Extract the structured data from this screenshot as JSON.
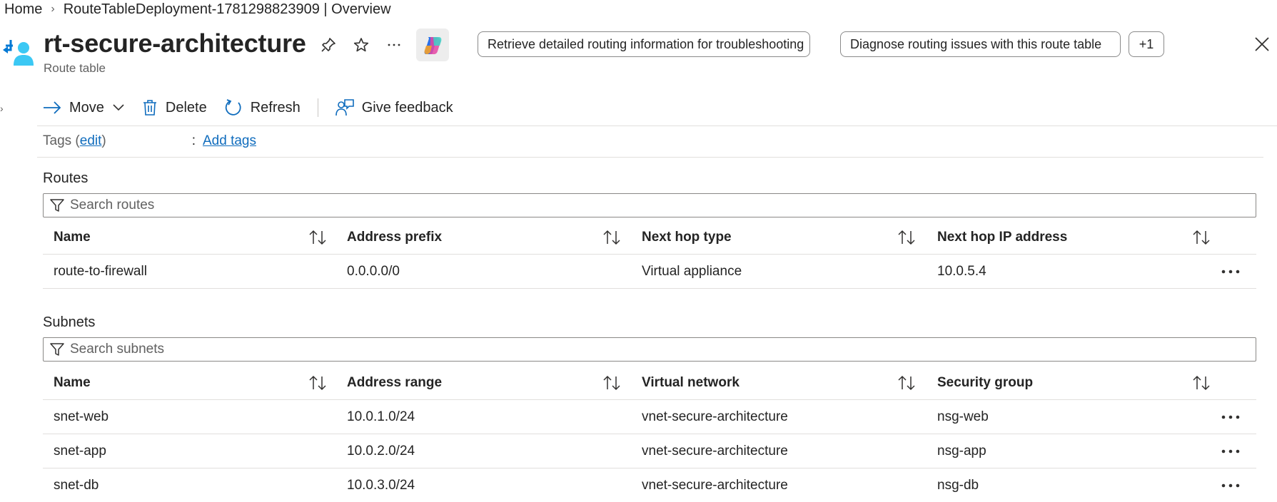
{
  "breadcrumb": {
    "home": "Home",
    "deployment": "RouteTableDeployment-1781298823909 | Overview"
  },
  "header": {
    "title": "rt-secure-architecture",
    "subtitle": "Route table",
    "icon": "route-table-icon"
  },
  "suggestions": {
    "chip1": "Retrieve detailed routing information for troubleshooting",
    "chip2": "Diagnose routing issues with this route table",
    "more": "+1"
  },
  "toolbar": {
    "move": "Move",
    "delete": "Delete",
    "refresh": "Refresh",
    "feedback": "Give feedback"
  },
  "tags": {
    "label": "Tags (",
    "edit": "edit",
    "label_end": ")",
    "colon": ":",
    "add": "Add tags"
  },
  "routes": {
    "title": "Routes",
    "search_placeholder": "Search routes",
    "columns": [
      "Name",
      "Address prefix",
      "Next hop type",
      "Next hop IP address"
    ],
    "rows": [
      [
        "route-to-firewall",
        "0.0.0.0/0",
        "Virtual appliance",
        "10.0.5.4"
      ]
    ]
  },
  "subnets": {
    "title": "Subnets",
    "search_placeholder": "Search subnets",
    "columns": [
      "Name",
      "Address range",
      "Virtual network",
      "Security group"
    ],
    "rows": [
      [
        "snet-web",
        "10.0.1.0/24",
        "vnet-secure-architecture",
        "nsg-web"
      ],
      [
        "snet-app",
        "10.0.2.0/24",
        "vnet-secure-architecture",
        "nsg-app"
      ],
      [
        "snet-db",
        "10.0.3.0/24",
        "vnet-secure-architecture",
        "nsg-db"
      ]
    ]
  },
  "colors": {
    "accent": "#0f6cbd",
    "text": "#242424",
    "muted": "#616161",
    "border": "#e1dfdd"
  }
}
